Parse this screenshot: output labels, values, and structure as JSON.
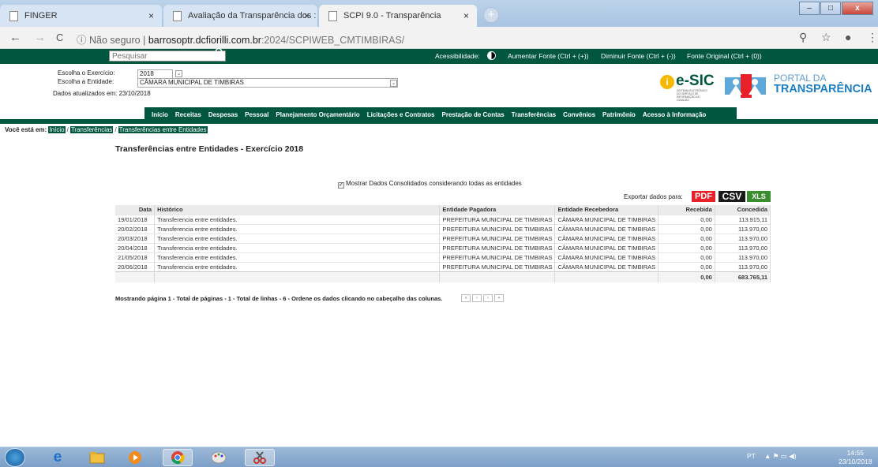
{
  "browser": {
    "tabs": [
      {
        "title": "FINGER",
        "close": "×"
      },
      {
        "title": "Avaliação da Transparência dos :",
        "close": "×"
      },
      {
        "title": "SCPI 9.0 - Transparência",
        "close": "×"
      }
    ],
    "new_tab": "+",
    "window_controls": {
      "minimize": "–",
      "maximize": "□",
      "close": "x"
    },
    "nav": {
      "back": "←",
      "forward": "→",
      "reload": "C",
      "info": "ⓘ"
    },
    "url": {
      "security": "Não seguro",
      "separator": "|",
      "host": "barrosoptr.dcfiorilli.com.br",
      "path": ":2024/SCPIWEB_CMTIMBIRAS/"
    },
    "toolbar_icons": {
      "zoom": "⚲",
      "star": "☆",
      "profile": "●",
      "menu": "⋮"
    }
  },
  "topbar": {
    "search_placeholder": "Pesquisar",
    "search_icon": "search-icon",
    "accessibility_label": "Acessibilidade:",
    "font_increase": "Aumentar Fonte (Ctrl + (+))",
    "font_decrease": "Diminuir Fonte (Ctrl + (-))",
    "font_original": "Fonte Original (Ctrl + (0))"
  },
  "params": {
    "exercicio_label": "Escolha o Exercício:",
    "exercicio_value": "2018",
    "entidade_label": "Escolha a Entidade:",
    "entidade_value": "CÂMARA MUNICIPAL DE TIMBIRAS",
    "atualizados": "Dados atualizados em: 23/10/2018"
  },
  "logos": {
    "esic_i": "i",
    "esic": "e-SIC",
    "esic_sub": "SISTEMA ELETRÔNICO DO SERVIÇO DE INFORMAÇÃO AO CIDADÃO",
    "portal_line1": "PORTAL DA",
    "portal_line2": "TRANSPARÊNCIA"
  },
  "menu": [
    "Início",
    "Receitas",
    "Despesas",
    "Pessoal",
    "Planejamento Orçamentário",
    "Licitações e Contratos",
    "Prestação de Contas",
    "Transferências",
    "Convênios",
    "Patrimônio",
    "Acesso à Informação"
  ],
  "breadcrumb": {
    "label": "Você está em:",
    "items": [
      "Início",
      "Transferências",
      "Transferências entre Entidades"
    ],
    "sep": "/"
  },
  "page": {
    "title": "Transferências entre Entidades - Exercício 2018",
    "consolidated": "Mostrar Dados Consolidados considerando todas as entidades",
    "export_label": "Exportar dados para:",
    "export_pdf": "PDF",
    "export_csv": "CSV",
    "export_xls": "XLS"
  },
  "table": {
    "headers": [
      "Data",
      "Histórico",
      "Entidade Pagadora",
      "Entidade Recebedora",
      "Recebida",
      "Concedida"
    ],
    "rows": [
      [
        "19/01/2018",
        "Transferencia entre entidades.",
        "PREFEITURA MUNICIPAL DE TIMBIRAS",
        "CÂMARA MUNICIPAL DE TIMBIRAS",
        "0,00",
        "113.915,11"
      ],
      [
        "20/02/2018",
        "Transferencia entre entidades.",
        "PREFEITURA MUNICIPAL DE TIMBIRAS",
        "CÂMARA MUNICIPAL DE TIMBIRAS",
        "0,00",
        "113.970,00"
      ],
      [
        "20/03/2018",
        "Transferencia entre entidades.",
        "PREFEITURA MUNICIPAL DE TIMBIRAS",
        "CÂMARA MUNICIPAL DE TIMBIRAS",
        "0,00",
        "113.970,00"
      ],
      [
        "20/04/2018",
        "Transferencia entre entidades.",
        "PREFEITURA MUNICIPAL DE TIMBIRAS",
        "CÂMARA MUNICIPAL DE TIMBIRAS",
        "0,00",
        "113.970,00"
      ],
      [
        "21/05/2018",
        "Transferencia entre entidades.",
        "PREFEITURA MUNICIPAL DE TIMBIRAS",
        "CÂMARA MUNICIPAL DE TIMBIRAS",
        "0,00",
        "113.970,00"
      ],
      [
        "20/06/2018",
        "Transferencia entre entidades.",
        "PREFEITURA MUNICIPAL DE TIMBIRAS",
        "CÂMARA MUNICIPAL DE TIMBIRAS",
        "0,00",
        "113.970,00"
      ]
    ],
    "total_recebida": "0,00",
    "total_concedida": "683.765,11"
  },
  "status": "Mostrando página 1 - Total de páginas - 1 - Total de linhas - 6 - Ordene os dados clicando no cabeçalho das colunas.",
  "pager": [
    "«",
    "‹",
    "›",
    "»"
  ],
  "taskbar": {
    "apps": [
      "windows-start",
      "internet-explorer",
      "file-explorer",
      "media-player",
      "chrome",
      "paint",
      "snipping-tool"
    ],
    "lang": "PT",
    "tray_icons": "▲  ⚑  ▭  ◀)",
    "time": "14:55",
    "date": "23/10/2018"
  },
  "colors": {
    "brand_green": "#00563f",
    "pdf_red": "#e8202a",
    "xls_green": "#3b8e2f",
    "portal_blue": "#1b7fc1"
  }
}
